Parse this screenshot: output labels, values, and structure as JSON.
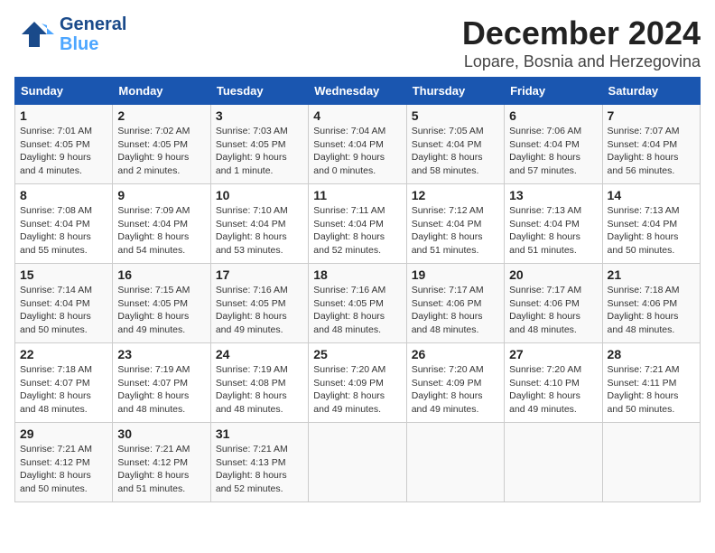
{
  "logo": {
    "name_general": "General",
    "name_blue": "Blue"
  },
  "header": {
    "month": "December 2024",
    "location": "Lopare, Bosnia and Herzegovina"
  },
  "columns": [
    "Sunday",
    "Monday",
    "Tuesday",
    "Wednesday",
    "Thursday",
    "Friday",
    "Saturday"
  ],
  "weeks": [
    [
      {
        "day": "1",
        "lines": [
          "Sunrise: 7:01 AM",
          "Sunset: 4:05 PM",
          "Daylight: 9 hours",
          "and 4 minutes."
        ]
      },
      {
        "day": "2",
        "lines": [
          "Sunrise: 7:02 AM",
          "Sunset: 4:05 PM",
          "Daylight: 9 hours",
          "and 2 minutes."
        ]
      },
      {
        "day": "3",
        "lines": [
          "Sunrise: 7:03 AM",
          "Sunset: 4:05 PM",
          "Daylight: 9 hours",
          "and 1 minute."
        ]
      },
      {
        "day": "4",
        "lines": [
          "Sunrise: 7:04 AM",
          "Sunset: 4:04 PM",
          "Daylight: 9 hours",
          "and 0 minutes."
        ]
      },
      {
        "day": "5",
        "lines": [
          "Sunrise: 7:05 AM",
          "Sunset: 4:04 PM",
          "Daylight: 8 hours",
          "and 58 minutes."
        ]
      },
      {
        "day": "6",
        "lines": [
          "Sunrise: 7:06 AM",
          "Sunset: 4:04 PM",
          "Daylight: 8 hours",
          "and 57 minutes."
        ]
      },
      {
        "day": "7",
        "lines": [
          "Sunrise: 7:07 AM",
          "Sunset: 4:04 PM",
          "Daylight: 8 hours",
          "and 56 minutes."
        ]
      }
    ],
    [
      {
        "day": "8",
        "lines": [
          "Sunrise: 7:08 AM",
          "Sunset: 4:04 PM",
          "Daylight: 8 hours",
          "and 55 minutes."
        ]
      },
      {
        "day": "9",
        "lines": [
          "Sunrise: 7:09 AM",
          "Sunset: 4:04 PM",
          "Daylight: 8 hours",
          "and 54 minutes."
        ]
      },
      {
        "day": "10",
        "lines": [
          "Sunrise: 7:10 AM",
          "Sunset: 4:04 PM",
          "Daylight: 8 hours",
          "and 53 minutes."
        ]
      },
      {
        "day": "11",
        "lines": [
          "Sunrise: 7:11 AM",
          "Sunset: 4:04 PM",
          "Daylight: 8 hours",
          "and 52 minutes."
        ]
      },
      {
        "day": "12",
        "lines": [
          "Sunrise: 7:12 AM",
          "Sunset: 4:04 PM",
          "Daylight: 8 hours",
          "and 51 minutes."
        ]
      },
      {
        "day": "13",
        "lines": [
          "Sunrise: 7:13 AM",
          "Sunset: 4:04 PM",
          "Daylight: 8 hours",
          "and 51 minutes."
        ]
      },
      {
        "day": "14",
        "lines": [
          "Sunrise: 7:13 AM",
          "Sunset: 4:04 PM",
          "Daylight: 8 hours",
          "and 50 minutes."
        ]
      }
    ],
    [
      {
        "day": "15",
        "lines": [
          "Sunrise: 7:14 AM",
          "Sunset: 4:04 PM",
          "Daylight: 8 hours",
          "and 50 minutes."
        ]
      },
      {
        "day": "16",
        "lines": [
          "Sunrise: 7:15 AM",
          "Sunset: 4:05 PM",
          "Daylight: 8 hours",
          "and 49 minutes."
        ]
      },
      {
        "day": "17",
        "lines": [
          "Sunrise: 7:16 AM",
          "Sunset: 4:05 PM",
          "Daylight: 8 hours",
          "and 49 minutes."
        ]
      },
      {
        "day": "18",
        "lines": [
          "Sunrise: 7:16 AM",
          "Sunset: 4:05 PM",
          "Daylight: 8 hours",
          "and 48 minutes."
        ]
      },
      {
        "day": "19",
        "lines": [
          "Sunrise: 7:17 AM",
          "Sunset: 4:06 PM",
          "Daylight: 8 hours",
          "and 48 minutes."
        ]
      },
      {
        "day": "20",
        "lines": [
          "Sunrise: 7:17 AM",
          "Sunset: 4:06 PM",
          "Daylight: 8 hours",
          "and 48 minutes."
        ]
      },
      {
        "day": "21",
        "lines": [
          "Sunrise: 7:18 AM",
          "Sunset: 4:06 PM",
          "Daylight: 8 hours",
          "and 48 minutes."
        ]
      }
    ],
    [
      {
        "day": "22",
        "lines": [
          "Sunrise: 7:18 AM",
          "Sunset: 4:07 PM",
          "Daylight: 8 hours",
          "and 48 minutes."
        ]
      },
      {
        "day": "23",
        "lines": [
          "Sunrise: 7:19 AM",
          "Sunset: 4:07 PM",
          "Daylight: 8 hours",
          "and 48 minutes."
        ]
      },
      {
        "day": "24",
        "lines": [
          "Sunrise: 7:19 AM",
          "Sunset: 4:08 PM",
          "Daylight: 8 hours",
          "and 48 minutes."
        ]
      },
      {
        "day": "25",
        "lines": [
          "Sunrise: 7:20 AM",
          "Sunset: 4:09 PM",
          "Daylight: 8 hours",
          "and 49 minutes."
        ]
      },
      {
        "day": "26",
        "lines": [
          "Sunrise: 7:20 AM",
          "Sunset: 4:09 PM",
          "Daylight: 8 hours",
          "and 49 minutes."
        ]
      },
      {
        "day": "27",
        "lines": [
          "Sunrise: 7:20 AM",
          "Sunset: 4:10 PM",
          "Daylight: 8 hours",
          "and 49 minutes."
        ]
      },
      {
        "day": "28",
        "lines": [
          "Sunrise: 7:21 AM",
          "Sunset: 4:11 PM",
          "Daylight: 8 hours",
          "and 50 minutes."
        ]
      }
    ],
    [
      {
        "day": "29",
        "lines": [
          "Sunrise: 7:21 AM",
          "Sunset: 4:12 PM",
          "Daylight: 8 hours",
          "and 50 minutes."
        ]
      },
      {
        "day": "30",
        "lines": [
          "Sunrise: 7:21 AM",
          "Sunset: 4:12 PM",
          "Daylight: 8 hours",
          "and 51 minutes."
        ]
      },
      {
        "day": "31",
        "lines": [
          "Sunrise: 7:21 AM",
          "Sunset: 4:13 PM",
          "Daylight: 8 hours",
          "and 52 minutes."
        ]
      },
      null,
      null,
      null,
      null
    ]
  ]
}
